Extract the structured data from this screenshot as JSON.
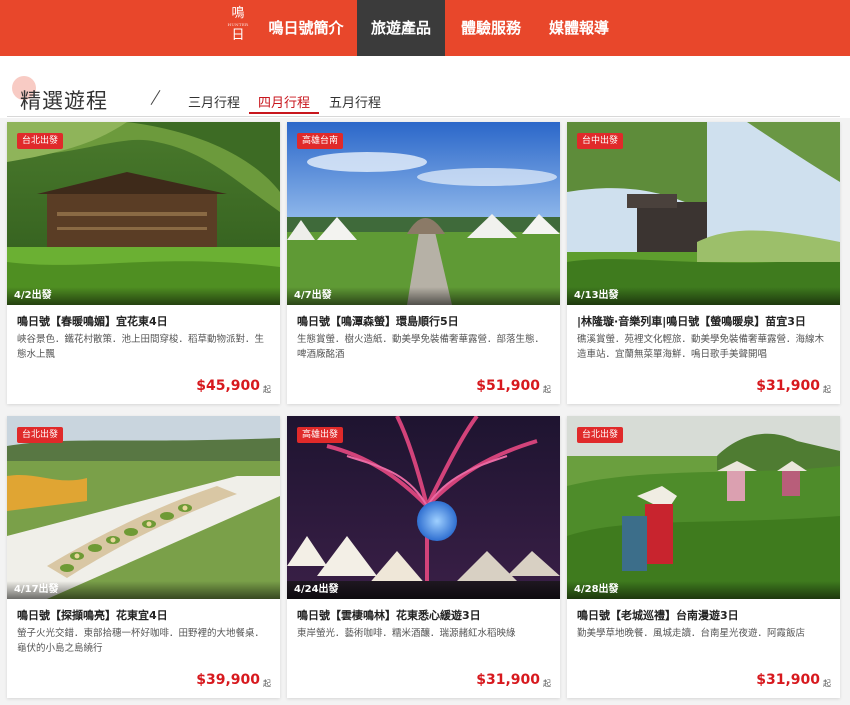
{
  "header": {
    "logo": {
      "top": "鳴",
      "small": "HUNTER",
      "bottom": "日"
    },
    "nav": [
      {
        "label": "鳴日號簡介"
      },
      {
        "label": "旅遊產品",
        "active": true
      },
      {
        "label": "體驗服務"
      },
      {
        "label": "媒體報導"
      }
    ]
  },
  "section": {
    "title": "精選遊程",
    "tabs": [
      {
        "label": "三月行程"
      },
      {
        "label": "四月行程",
        "active": true
      },
      {
        "label": "五月行程"
      }
    ]
  },
  "products": [
    {
      "badge": "台北出發",
      "date": "4/2出發",
      "title": "鳴日號【春暖鳴媚】宜花東4日",
      "desc": "峽谷景色．鐵花村散策．池上田間穿梭．稻草動物派對．生態水上飄",
      "price": "$45,900",
      "unit": "起"
    },
    {
      "badge": "高雄台南",
      "date": "4/7出發",
      "title": "鳴日號【鳴潭森螢】環島順行5日",
      "desc": "生態賞螢．樹火造紙．動美學免裝備奢華露營．部落生態．啤酒廠酩酒",
      "price": "$51,900",
      "unit": "起"
    },
    {
      "badge": "台中出發",
      "date": "4/13出發",
      "title": "|林隆璇·音樂列車|鳴日號【螢鳴暖泉】苗宜3日",
      "desc": "礁溪賞螢．苑裡文化輕旅．動美學免裝備奢華露營．海線木造車站．宜蘭無菜單海鮮．鳴日歌手美聲開唱",
      "price": "$31,900",
      "unit": "起"
    },
    {
      "badge": "台北出發",
      "date": "4/17出發",
      "title": "鳴日號【探擷鳴亮】花東宜4日",
      "desc": "螢子火光交錯．東部拾穗一杯好咖啡．田野裡的大地餐桌．龜伏的小島之島繞行",
      "price": "$39,900",
      "unit": "起"
    },
    {
      "badge": "高雄出發",
      "date": "4/24出發",
      "title": "鳴日號【雲棲鳴林】花東悉心緩遊3日",
      "desc": "東岸螢光．藝術咖啡．糯米酒釀．瑞源赭紅水稻映綠",
      "price": "$31,900",
      "unit": "起"
    },
    {
      "badge": "台北出發",
      "date": "4/28出發",
      "title": "鳴日號【老城巡禮】台南漫遊3日",
      "desc": "勤美學草地晚餐．風城走讀．台南星光夜遊．阿霞飯店",
      "price": "$31,900",
      "unit": "起"
    }
  ]
}
